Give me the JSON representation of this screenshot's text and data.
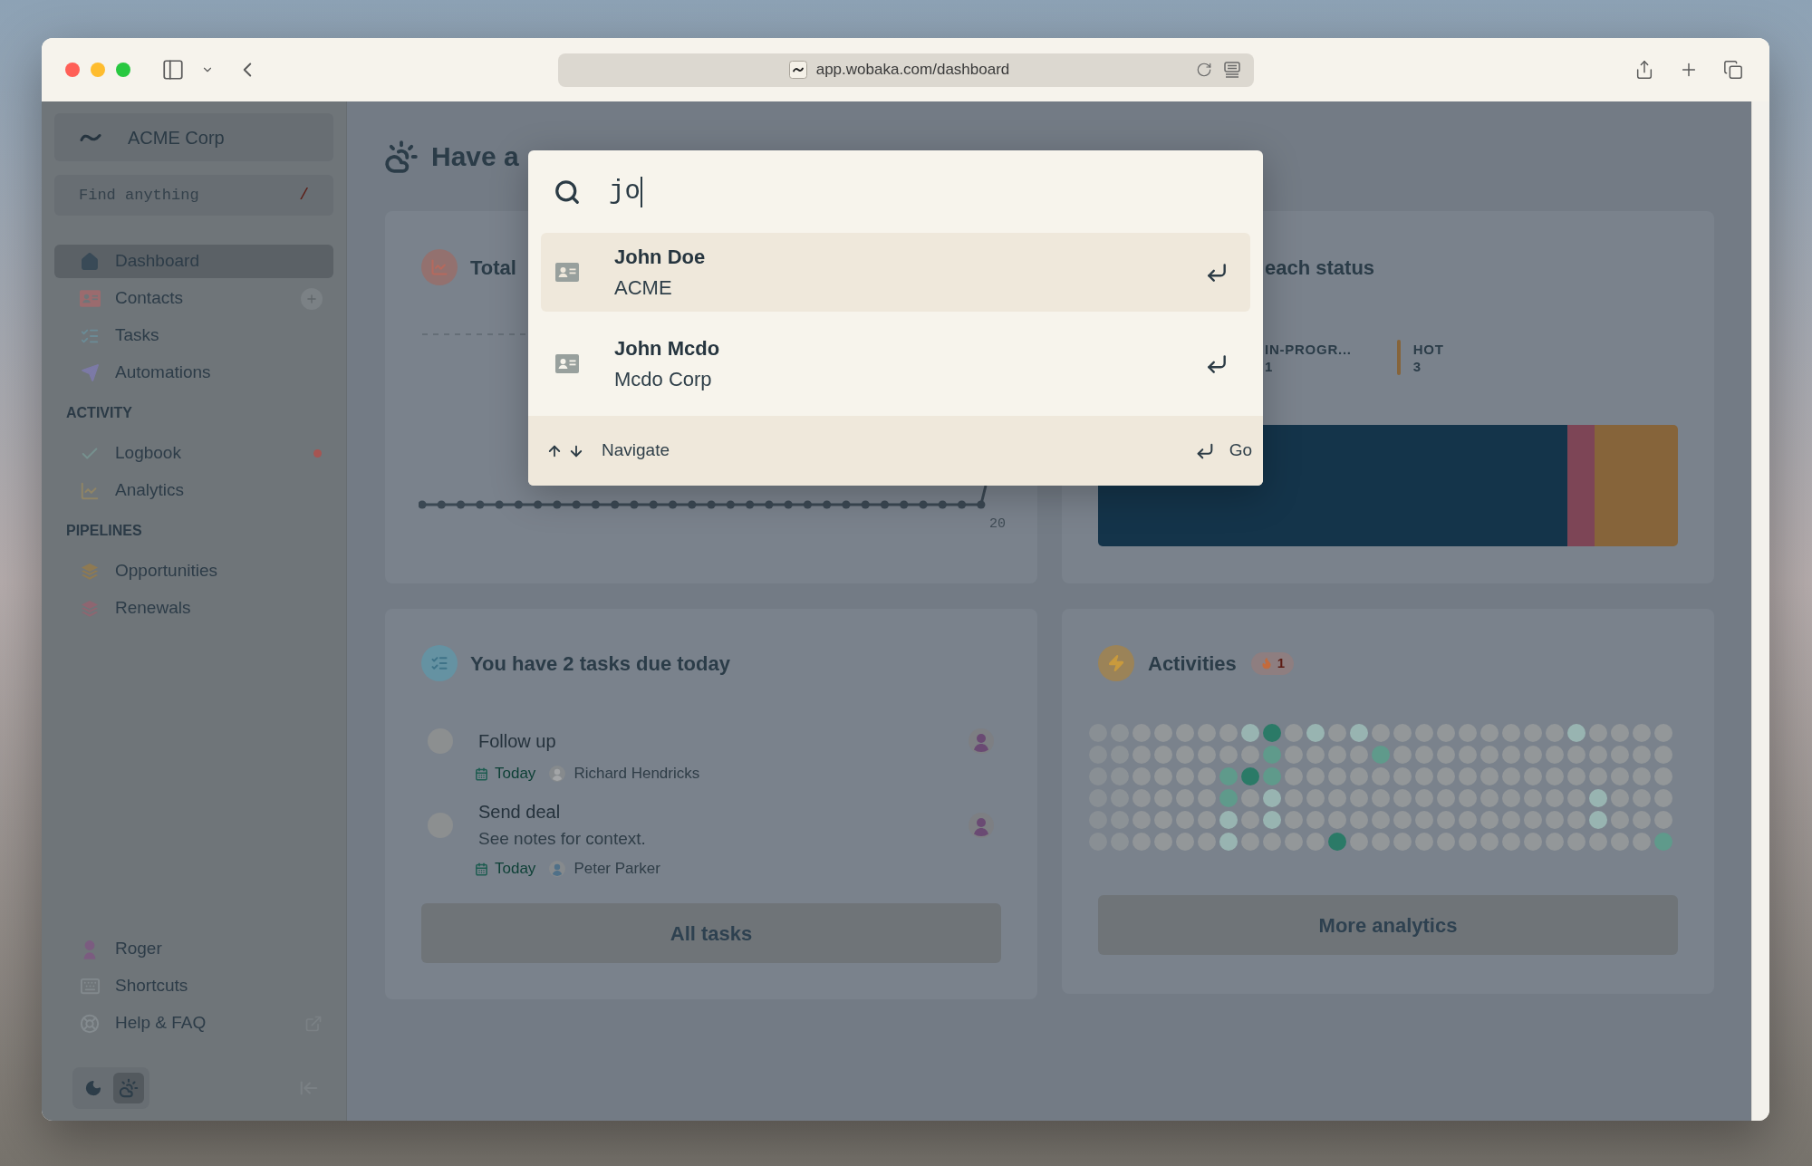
{
  "browser": {
    "url": "app.wobaka.com/dashboard"
  },
  "sidebar": {
    "workspace": "ACME Corp",
    "search": {
      "placeholder": "Find anything",
      "shortcut": "/"
    },
    "nav": [
      {
        "label": "Dashboard",
        "selected": true,
        "add_button": false
      },
      {
        "label": "Contacts",
        "selected": false,
        "add_button": true
      },
      {
        "label": "Tasks",
        "selected": false,
        "add_button": false
      },
      {
        "label": "Automations",
        "selected": false,
        "add_button": false
      }
    ],
    "sections": [
      {
        "title": "ACTIVITY",
        "items": [
          {
            "label": "Logbook",
            "selected": false,
            "unread": true
          },
          {
            "label": "Analytics",
            "selected": false,
            "unread": false
          }
        ]
      },
      {
        "title": "PIPELINES",
        "items": [
          {
            "label": "Opportunities",
            "selected": false,
            "color": "#8f7a52"
          },
          {
            "label": "Renewals",
            "selected": false,
            "color": "#8e6671"
          }
        ]
      }
    ],
    "footer": [
      {
        "label": "Roger",
        "external": false
      },
      {
        "label": "Shortcuts",
        "external": false
      },
      {
        "label": "Help & FAQ",
        "external": true
      }
    ],
    "theme_modes": [
      {
        "selected": false
      },
      {
        "selected": true
      }
    ]
  },
  "greeting": "Have a",
  "search_dialog": {
    "query": "jo",
    "results": [
      {
        "name": "John Doe",
        "subtitle": "ACME",
        "selected": true
      },
      {
        "name": "John Mcdo",
        "subtitle": "Mcdo Corp",
        "selected": false
      }
    ],
    "navigate_hint": "Navigate",
    "go_hint": "Go"
  },
  "total_card": {
    "title": "Total",
    "axis_label": "20"
  },
  "status_card": {
    "title": "each status",
    "legend": [
      {
        "label": "IN-PROGR...",
        "count": "1"
      },
      {
        "label": "HOT",
        "count": "3",
        "color": "#86643a"
      }
    ]
  },
  "tasks_card": {
    "title": "You have 2 tasks due today",
    "tasks": [
      {
        "title": "Follow up",
        "done": false,
        "due": "Today",
        "assignee": "Richard Hendricks"
      },
      {
        "title": "Send deal",
        "note": "See notes for context.",
        "done": false,
        "due": "Today",
        "assignee": "Peter Parker"
      }
    ],
    "button": "All tasks"
  },
  "activities_card": {
    "title": "Activities",
    "streak": "1",
    "grid": [
      {
        "cells": [
          {
            "kind": "none"
          },
          {
            "kind": "none"
          },
          {
            "kind": "none"
          },
          {
            "kind": "none"
          },
          {
            "kind": "none"
          },
          {
            "kind": "none"
          },
          {
            "kind": "none"
          },
          {
            "kind": "low"
          },
          {
            "kind": "high"
          },
          {
            "kind": "none"
          },
          {
            "kind": "low"
          },
          {
            "kind": "none"
          },
          {
            "kind": "low"
          },
          {
            "kind": "none"
          },
          {
            "kind": "none"
          },
          {
            "kind": "none"
          },
          {
            "kind": "none"
          },
          {
            "kind": "none"
          },
          {
            "kind": "none"
          },
          {
            "kind": "none"
          },
          {
            "kind": "none"
          },
          {
            "kind": "none"
          },
          {
            "kind": "low"
          },
          {
            "kind": "none"
          },
          {
            "kind": "none"
          },
          {
            "kind": "none"
          },
          {
            "kind": "none"
          }
        ]
      },
      {
        "cells": [
          {
            "kind": "none"
          },
          {
            "kind": "none"
          },
          {
            "kind": "none"
          },
          {
            "kind": "none"
          },
          {
            "kind": "none"
          },
          {
            "kind": "none"
          },
          {
            "kind": "none"
          },
          {
            "kind": "none"
          },
          {
            "kind": "mid"
          },
          {
            "kind": "none"
          },
          {
            "kind": "none"
          },
          {
            "kind": "none"
          },
          {
            "kind": "none"
          },
          {
            "kind": "mid"
          },
          {
            "kind": "none"
          },
          {
            "kind": "none"
          },
          {
            "kind": "none"
          },
          {
            "kind": "none"
          },
          {
            "kind": "none"
          },
          {
            "kind": "none"
          },
          {
            "kind": "none"
          },
          {
            "kind": "none"
          },
          {
            "kind": "none"
          },
          {
            "kind": "none"
          },
          {
            "kind": "none"
          },
          {
            "kind": "none"
          },
          {
            "kind": "none"
          }
        ]
      },
      {
        "cells": [
          {
            "kind": "none"
          },
          {
            "kind": "none"
          },
          {
            "kind": "none"
          },
          {
            "kind": "none"
          },
          {
            "kind": "none"
          },
          {
            "kind": "none"
          },
          {
            "kind": "mid"
          },
          {
            "kind": "high"
          },
          {
            "kind": "mid"
          },
          {
            "kind": "none"
          },
          {
            "kind": "none"
          },
          {
            "kind": "none"
          },
          {
            "kind": "none"
          },
          {
            "kind": "none"
          },
          {
            "kind": "none"
          },
          {
            "kind": "none"
          },
          {
            "kind": "none"
          },
          {
            "kind": "none"
          },
          {
            "kind": "none"
          },
          {
            "kind": "none"
          },
          {
            "kind": "none"
          },
          {
            "kind": "none"
          },
          {
            "kind": "none"
          },
          {
            "kind": "none"
          },
          {
            "kind": "none"
          },
          {
            "kind": "none"
          },
          {
            "kind": "none"
          }
        ]
      },
      {
        "cells": [
          {
            "kind": "none"
          },
          {
            "kind": "none"
          },
          {
            "kind": "none"
          },
          {
            "kind": "none"
          },
          {
            "kind": "none"
          },
          {
            "kind": "none"
          },
          {
            "kind": "mid"
          },
          {
            "kind": "none"
          },
          {
            "kind": "low"
          },
          {
            "kind": "none"
          },
          {
            "kind": "none"
          },
          {
            "kind": "none"
          },
          {
            "kind": "none"
          },
          {
            "kind": "none"
          },
          {
            "kind": "none"
          },
          {
            "kind": "none"
          },
          {
            "kind": "none"
          },
          {
            "kind": "none"
          },
          {
            "kind": "none"
          },
          {
            "kind": "none"
          },
          {
            "kind": "none"
          },
          {
            "kind": "none"
          },
          {
            "kind": "none"
          },
          {
            "kind": "low"
          },
          {
            "kind": "none"
          },
          {
            "kind": "none"
          },
          {
            "kind": "none"
          }
        ]
      },
      {
        "cells": [
          {
            "kind": "none"
          },
          {
            "kind": "none"
          },
          {
            "kind": "none"
          },
          {
            "kind": "none"
          },
          {
            "kind": "none"
          },
          {
            "kind": "none"
          },
          {
            "kind": "low"
          },
          {
            "kind": "none"
          },
          {
            "kind": "low"
          },
          {
            "kind": "none"
          },
          {
            "kind": "none"
          },
          {
            "kind": "none"
          },
          {
            "kind": "none"
          },
          {
            "kind": "none"
          },
          {
            "kind": "none"
          },
          {
            "kind": "none"
          },
          {
            "kind": "none"
          },
          {
            "kind": "none"
          },
          {
            "kind": "none"
          },
          {
            "kind": "none"
          },
          {
            "kind": "none"
          },
          {
            "kind": "none"
          },
          {
            "kind": "none"
          },
          {
            "kind": "low"
          },
          {
            "kind": "none"
          },
          {
            "kind": "none"
          },
          {
            "kind": "none"
          }
        ]
      },
      {
        "cells": [
          {
            "kind": "none"
          },
          {
            "kind": "none"
          },
          {
            "kind": "none"
          },
          {
            "kind": "none"
          },
          {
            "kind": "none"
          },
          {
            "kind": "none"
          },
          {
            "kind": "low"
          },
          {
            "kind": "none"
          },
          {
            "kind": "none"
          },
          {
            "kind": "none"
          },
          {
            "kind": "none"
          },
          {
            "kind": "high"
          },
          {
            "kind": "none"
          },
          {
            "kind": "none"
          },
          {
            "kind": "none"
          },
          {
            "kind": "none"
          },
          {
            "kind": "none"
          },
          {
            "kind": "none"
          },
          {
            "kind": "none"
          },
          {
            "kind": "none"
          },
          {
            "kind": "none"
          },
          {
            "kind": "none"
          },
          {
            "kind": "none"
          },
          {
            "kind": "none"
          },
          {
            "kind": "none"
          },
          {
            "kind": "none"
          },
          {
            "kind": "mid"
          }
        ]
      }
    ],
    "button": "More analytics"
  }
}
